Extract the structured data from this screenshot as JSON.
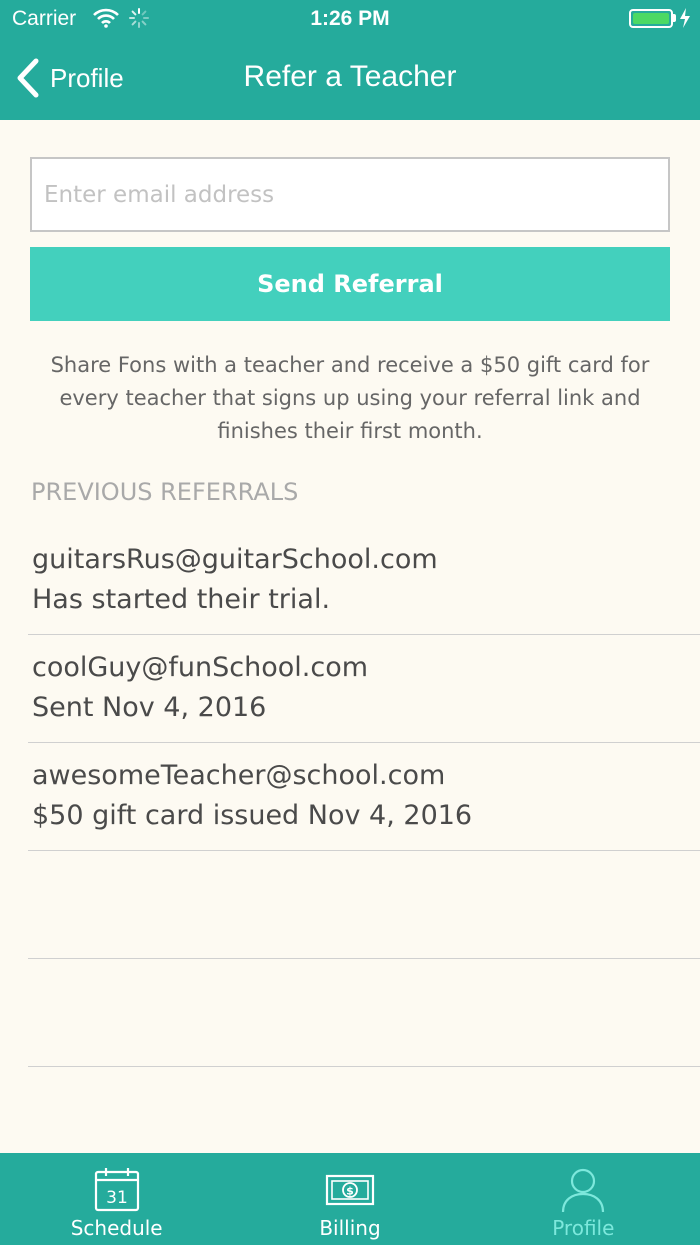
{
  "status_bar": {
    "carrier": "Carrier",
    "time": "1:26 PM",
    "battery_color": "#4cd964"
  },
  "nav": {
    "back_label": "Profile",
    "title": "Refer a Teacher"
  },
  "form": {
    "email_placeholder": "Enter email address",
    "email_value": "",
    "send_label": "Send Referral"
  },
  "description": "Share Fons with a teacher and receive a $50 gift card for every teacher that signs up using your referral link and finishes their first month.",
  "referrals": {
    "heading": "PREVIOUS REFERRALS",
    "items": [
      {
        "email": "guitarsRus@guitarSchool.com",
        "status": "Has started their trial."
      },
      {
        "email": "coolGuy@funSchool.com",
        "status": "Sent Nov 4, 2016"
      },
      {
        "email": "awesomeTeacher@school.com",
        "status": "$50 gift card issued Nov 4, 2016"
      },
      {
        "email": "",
        "status": ""
      },
      {
        "email": "",
        "status": ""
      }
    ]
  },
  "tab_bar": {
    "tabs": [
      {
        "label": "Schedule",
        "icon": "calendar-icon",
        "calendar_day": "31",
        "active": false
      },
      {
        "label": "Billing",
        "icon": "billing-icon",
        "active": false
      },
      {
        "label": "Profile",
        "icon": "profile-icon",
        "active": true
      }
    ]
  },
  "colors": {
    "header": "#25ab9c",
    "button": "#43d0bd",
    "background": "#fdfaf2",
    "active_tab": "#7de8dc"
  }
}
